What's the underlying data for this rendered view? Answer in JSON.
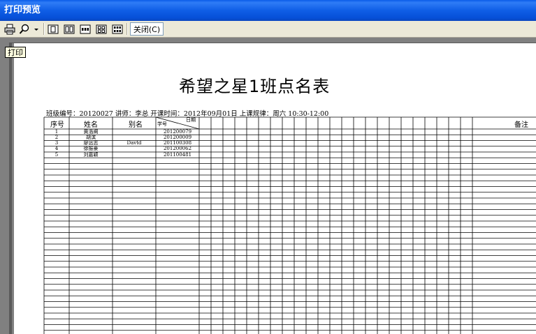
{
  "window": {
    "title": "打印预览"
  },
  "toolbar": {
    "icons": [
      "printer-icon",
      "zoom-icon",
      "one-page-icon",
      "two-pages-icon",
      "three-pages-icon",
      "four-pages-icon",
      "six-pages-icon"
    ],
    "close_label": "关闭(C)"
  },
  "tooltip": {
    "text": "打印"
  },
  "document": {
    "title": "希望之星1班点名表",
    "info": "班级编号：20120027 讲师：李总 开课时间：2012年09月01日 上课规律：周六 10:30-12:00",
    "headers": {
      "seq": "序号",
      "name": "姓名",
      "alias": "别名",
      "student_id": "学号",
      "date": "日期",
      "remark": "备注"
    },
    "rows": [
      {
        "seq": "1",
        "name": "黄浩阐",
        "alias": "",
        "student_id": "201200079"
      },
      {
        "seq": "2",
        "name": "胡滨",
        "alias": "",
        "student_id": "201200009"
      },
      {
        "seq": "3",
        "name": "廖远志",
        "alias": "Davtd",
        "student_id": "201100308"
      },
      {
        "seq": "4",
        "name": "徐振豪",
        "alias": "",
        "student_id": "201200062"
      },
      {
        "seq": "5",
        "name": "刘嘉颖",
        "alias": "",
        "student_id": "201100481"
      }
    ]
  }
}
